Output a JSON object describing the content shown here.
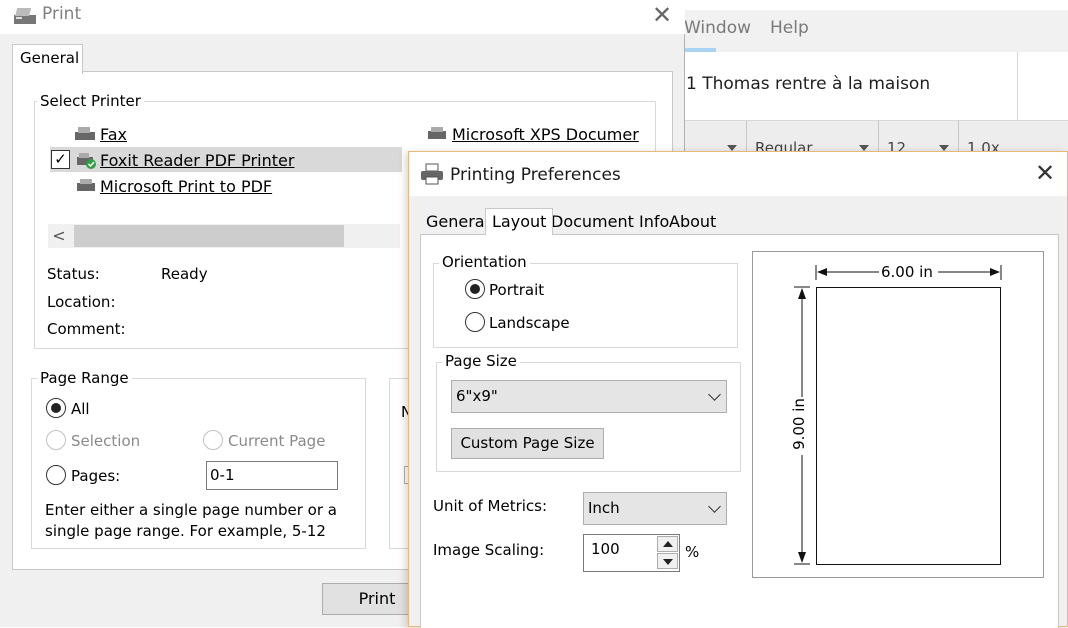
{
  "background_app": {
    "menu": [
      "Window",
      "Help"
    ],
    "document_title": "1 Thomas rentre à la maison",
    "ribbon": {
      "style": "Regular",
      "size": "12",
      "spacing": "1.0x"
    }
  },
  "print_dialog": {
    "title": "Print",
    "tabs": [
      "General"
    ],
    "select_printer": {
      "legend": "Select Printer",
      "printers": [
        "Fax",
        "Foxit Reader PDF Printer",
        "Microsoft Print to PDF",
        "Microsoft XPS Documer"
      ],
      "selected": "Foxit Reader PDF Printer"
    },
    "status": {
      "status_label": "Status:",
      "status_value": "Ready",
      "location_label": "Location:",
      "comment_label": "Comment:"
    },
    "page_range": {
      "legend": "Page Range",
      "all": "All",
      "selection": "Selection",
      "current_page": "Current Page",
      "pages": "Pages:",
      "pages_value": "0-1",
      "selected": "All",
      "help_text": "Enter either a single page number or a single page range.  For example, 5-12"
    },
    "copies_fragment": "N",
    "print_button": "Print"
  },
  "prefs_dialog": {
    "title": "Printing Preferences",
    "tabs": [
      "General",
      "Layout",
      "Document Info",
      "About"
    ],
    "active_tab": "Layout",
    "orientation": {
      "legend": "Orientation",
      "portrait": "Portrait",
      "landscape": "Landscape",
      "selected": "Portrait"
    },
    "page_size": {
      "legend": "Page Size",
      "value": "6\"x9\"",
      "custom_button": "Custom Page Size"
    },
    "unit_label": "Unit of Metrics:",
    "unit_value": "Inch",
    "scaling_label": "Image Scaling:",
    "scaling_value": "100",
    "scaling_unit": "%",
    "preview": {
      "width_label": "6.00 in",
      "height_label": "9.00 in"
    }
  }
}
